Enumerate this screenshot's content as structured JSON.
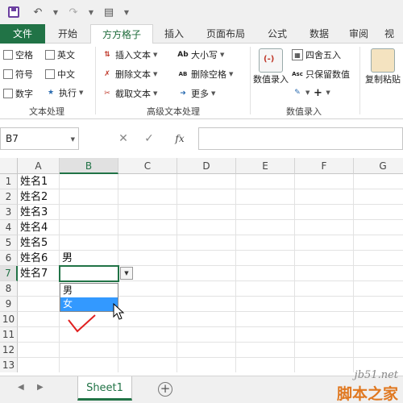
{
  "colors": {
    "excel_green": "#217346",
    "highlight_blue": "#3399ff",
    "checkmark_red": "#e02020"
  },
  "tabs": [
    {
      "label": "文件"
    },
    {
      "label": "开始"
    },
    {
      "label": "方方格子"
    },
    {
      "label": "插入"
    },
    {
      "label": "页面布局"
    },
    {
      "label": "公式"
    },
    {
      "label": "数据"
    },
    {
      "label": "审阅"
    },
    {
      "label": "视"
    }
  ],
  "ribbon": {
    "text_group": {
      "label": "文本处理",
      "checks": [
        "空格",
        "英文",
        "符号",
        "中文",
        "数字"
      ],
      "execute": "执行"
    },
    "adv_group": {
      "label": "高级文本处理",
      "insert_text": "插入文本",
      "delete_text": "删除文本",
      "extract_text": "截取文本",
      "case": "大小写",
      "delete_space": "删除空格",
      "more": "更多"
    },
    "entry_group": {
      "label": "数值录入",
      "numeric_entry": "数值录入",
      "round": "四舍五入",
      "keep_value": "只保留数值",
      "copy_paste": "复制粘贴"
    }
  },
  "formula_bar": {
    "name_box": "B7",
    "cancel": "✕",
    "confirm": "✓",
    "fx": "fx"
  },
  "grid": {
    "columns": [
      "A",
      "B",
      "C",
      "D",
      "E",
      "F",
      "G"
    ],
    "rows": [
      "1",
      "2",
      "3",
      "4",
      "5",
      "6",
      "7",
      "8",
      "9",
      "10",
      "11",
      "12",
      "13"
    ],
    "a_values": [
      "姓名1",
      "姓名2",
      "姓名3",
      "姓名4",
      "姓名5",
      "姓名6",
      "姓名7"
    ],
    "b6": "男",
    "dropdown_options": [
      "男",
      "女"
    ],
    "selected_option": "女"
  },
  "sheets": {
    "tab": "Sheet1",
    "add": "+"
  },
  "watermark": {
    "site": "jb51.net",
    "name": "脚本之家"
  }
}
